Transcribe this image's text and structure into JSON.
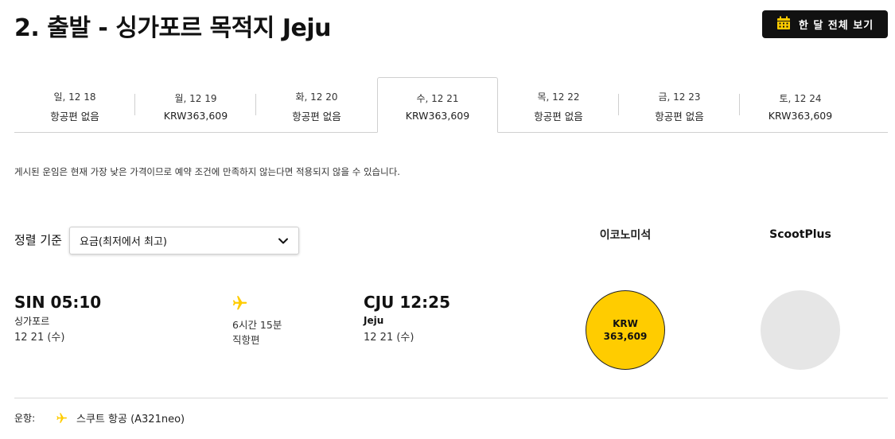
{
  "header": {
    "title": "2. 출발 - 싱가포르 목적지 Jeju",
    "month_button_label": "한 달 전체 보기"
  },
  "date_tabs": [
    {
      "label": "일, 12 18",
      "price": "항공편 없음",
      "active": false
    },
    {
      "label": "월, 12 19",
      "price": "KRW363,609",
      "active": false
    },
    {
      "label": "화, 12 20",
      "price": "항공편 없음",
      "active": false
    },
    {
      "label": "수, 12 21",
      "price": "KRW363,609",
      "active": true
    },
    {
      "label": "목, 12 22",
      "price": "항공편 없음",
      "active": false
    },
    {
      "label": "금, 12 23",
      "price": "항공편 없음",
      "active": false
    },
    {
      "label": "토, 12 24",
      "price": "KRW363,609",
      "active": false
    }
  ],
  "disclaimer": "게시된 운임은 현재 가장 낮은 가격이므로 예약 조건에 만족하지 않는다면 적용되지 않을 수 있습니다.",
  "sort": {
    "label": "정렬 기준",
    "selected": "요금(최저에서 최고)"
  },
  "columns": {
    "economy": "이코노미석",
    "plus": "ScootPlus"
  },
  "flight": {
    "departure": {
      "time": "SIN 05:10",
      "city": "싱가포르",
      "date": "12 21 (수)"
    },
    "duration": "6시간 15분",
    "stops": "직항편",
    "arrival": {
      "time": "CJU 12:25",
      "city": "Jeju",
      "date": "12 21 (수)"
    },
    "economy_fare": {
      "currency": "KRW",
      "amount": "363,609"
    }
  },
  "operator": {
    "label": "운항:",
    "airline": "스쿠트 항공  (A321neo)"
  },
  "colors": {
    "brand_yellow": "#ffcc00",
    "dark": "#111111",
    "empty_circle": "#e6e6e6"
  }
}
